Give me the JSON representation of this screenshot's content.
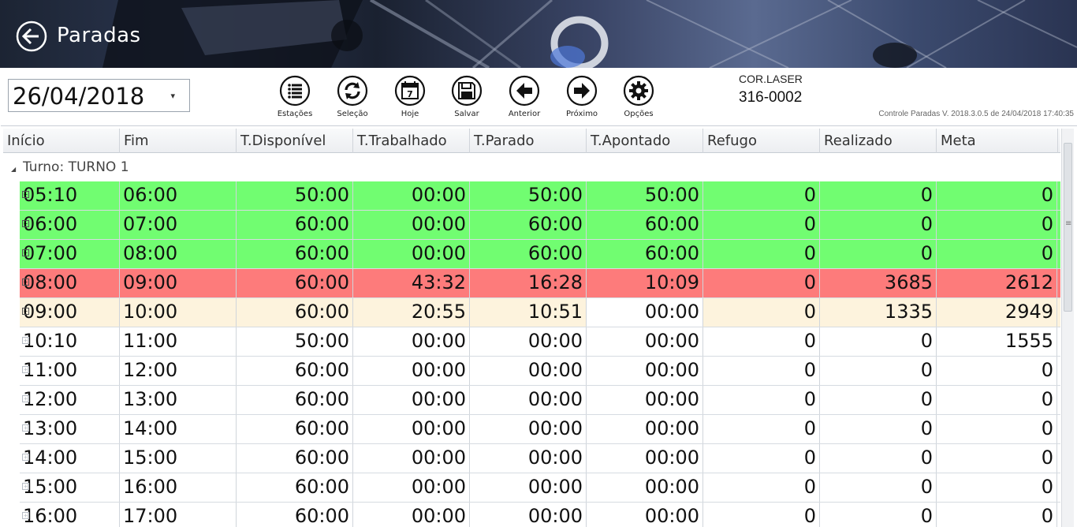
{
  "window": {
    "title": "Paradas"
  },
  "toolbar": {
    "date": "26/04/2018",
    "buttons": [
      {
        "id": "estacoes",
        "label": "Estações",
        "icon": "list-icon"
      },
      {
        "id": "selecao",
        "label": "Seleção",
        "icon": "refresh-icon"
      },
      {
        "id": "hoje",
        "label": "Hoje",
        "icon": "calendar-icon",
        "calendar_day": "7"
      },
      {
        "id": "salvar",
        "label": "Salvar",
        "icon": "floppy-icon"
      },
      {
        "id": "anterior",
        "label": "Anterior",
        "icon": "arrow-left-icon"
      },
      {
        "id": "proximo",
        "label": "Próximo",
        "icon": "arrow-right-icon"
      },
      {
        "id": "opcoes",
        "label": "Opções",
        "icon": "gear-icon"
      }
    ],
    "station_name": "COR.LASER",
    "station_code": "316-0002",
    "version": "Controle Paradas V. 2018.3.0.5 de 24/04/2018 17:40:35"
  },
  "grid": {
    "columns": [
      "Início",
      "Fim",
      "T.Disponível",
      "T.Trabalhado",
      "T.Parado",
      "T.Apontado",
      "Refugo",
      "Realizado",
      "Meta"
    ],
    "group_label": "Turno: TURNO 1",
    "row_colors": {
      "green": "#71fd71",
      "red": "#fd7b7b",
      "yellow": "#fdf3dd",
      "none": "#ffffff"
    },
    "rows": [
      {
        "status": "green",
        "cells": [
          "05:10",
          "06:00",
          "50:00",
          "00:00",
          "50:00",
          "50:00",
          "0",
          "0",
          "0"
        ]
      },
      {
        "status": "green",
        "cells": [
          "06:00",
          "07:00",
          "60:00",
          "00:00",
          "60:00",
          "60:00",
          "0",
          "0",
          "0"
        ]
      },
      {
        "status": "green",
        "cells": [
          "07:00",
          "08:00",
          "60:00",
          "00:00",
          "60:00",
          "60:00",
          "0",
          "0",
          "0"
        ]
      },
      {
        "status": "red",
        "cells": [
          "08:00",
          "09:00",
          "60:00",
          "43:32",
          "16:28",
          "10:09",
          "0",
          "3685",
          "2612"
        ]
      },
      {
        "status": "yellow",
        "cells": [
          "09:00",
          "10:00",
          "60:00",
          "20:55",
          "10:51",
          "00:00",
          "0",
          "1335",
          "2949"
        ]
      },
      {
        "status": "none",
        "cells": [
          "10:10",
          "11:00",
          "50:00",
          "00:00",
          "00:00",
          "00:00",
          "0",
          "0",
          "1555"
        ]
      },
      {
        "status": "none",
        "cells": [
          "11:00",
          "12:00",
          "60:00",
          "00:00",
          "00:00",
          "00:00",
          "0",
          "0",
          "0"
        ]
      },
      {
        "status": "none",
        "cells": [
          "12:00",
          "13:00",
          "60:00",
          "00:00",
          "00:00",
          "00:00",
          "0",
          "0",
          "0"
        ]
      },
      {
        "status": "none",
        "cells": [
          "13:00",
          "14:00",
          "60:00",
          "00:00",
          "00:00",
          "00:00",
          "0",
          "0",
          "0"
        ]
      },
      {
        "status": "none",
        "cells": [
          "14:00",
          "15:00",
          "60:00",
          "00:00",
          "00:00",
          "00:00",
          "0",
          "0",
          "0"
        ]
      },
      {
        "status": "none",
        "cells": [
          "15:00",
          "16:00",
          "60:00",
          "00:00",
          "00:00",
          "00:00",
          "0",
          "0",
          "0"
        ]
      },
      {
        "status": "none",
        "cells": [
          "16:00",
          "17:00",
          "60:00",
          "00:00",
          "00:00",
          "00:00",
          "0",
          "0",
          "0"
        ]
      }
    ]
  }
}
